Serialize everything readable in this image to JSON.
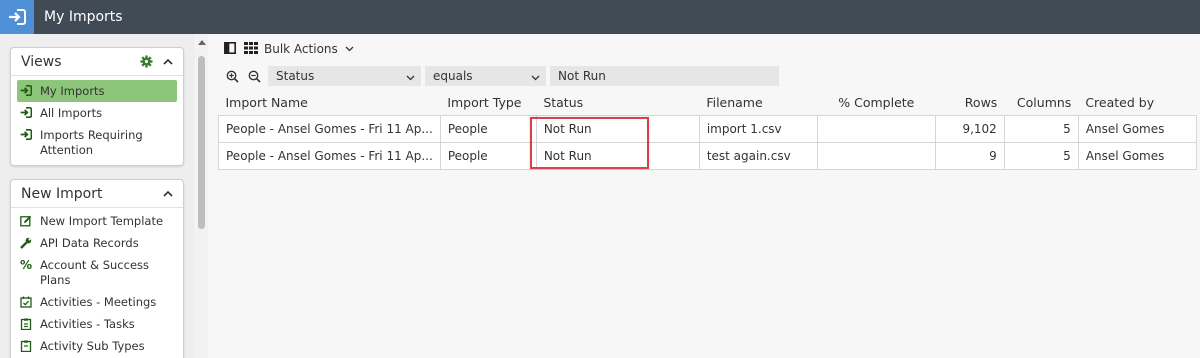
{
  "header": {
    "title": "My Imports"
  },
  "views_panel": {
    "title": "Views",
    "items": [
      {
        "label": "My Imports"
      },
      {
        "label": "All Imports"
      },
      {
        "label": "Imports Requiring Attention"
      }
    ]
  },
  "new_import_panel": {
    "title": "New Import",
    "items": [
      {
        "label": "New Import Template"
      },
      {
        "label": "API Data Records"
      },
      {
        "label": "Account & Success Plans"
      },
      {
        "label": "Activities - Meetings"
      },
      {
        "label": "Activities - Tasks"
      },
      {
        "label": "Activity Sub Types"
      }
    ]
  },
  "toolbar": {
    "bulk_actions_label": "Bulk Actions"
  },
  "filter": {
    "field": "Status",
    "operator": "equals",
    "value": "Not Run"
  },
  "table": {
    "columns": [
      "Import Name",
      "Import Type",
      "Status",
      "Filename",
      "% Complete",
      "Rows",
      "Columns",
      "Created by"
    ],
    "rows": [
      {
        "import_name": "People - Ansel Gomes - Fri 11 Ap...",
        "import_type": "People",
        "status": "Not Run",
        "filename": "import 1.csv",
        "complete": "",
        "rows": "9,102",
        "columns": "5",
        "created_by": "Ansel Gomes"
      },
      {
        "import_name": "People - Ansel Gomes - Fri 11 Ap...",
        "import_type": "People",
        "status": "Not Run",
        "filename": "test again.csv",
        "complete": "",
        "rows": "9",
        "columns": "5",
        "created_by": "Ansel Gomes"
      }
    ]
  },
  "colors": {
    "topbar": "#404b56",
    "app_icon_bg": "#4f8fd6",
    "active_item": "#8dc67a",
    "highlight": "#d9414a",
    "icon_green": "#3a7d2c"
  }
}
